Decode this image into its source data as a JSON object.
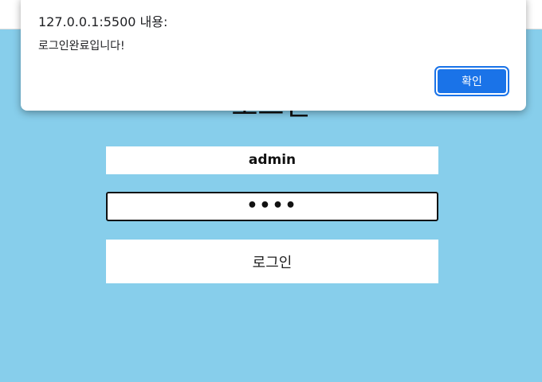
{
  "page": {
    "title": "로그인",
    "background": "#87ceeb"
  },
  "form": {
    "username_value": "admin",
    "password_value": "••••",
    "login_label": "로그인"
  },
  "dialog": {
    "origin": "127.0.0.1:5500 내용:",
    "message": "로그인완료입니다!",
    "ok_label": "확인",
    "accent": "#1a73e8"
  }
}
